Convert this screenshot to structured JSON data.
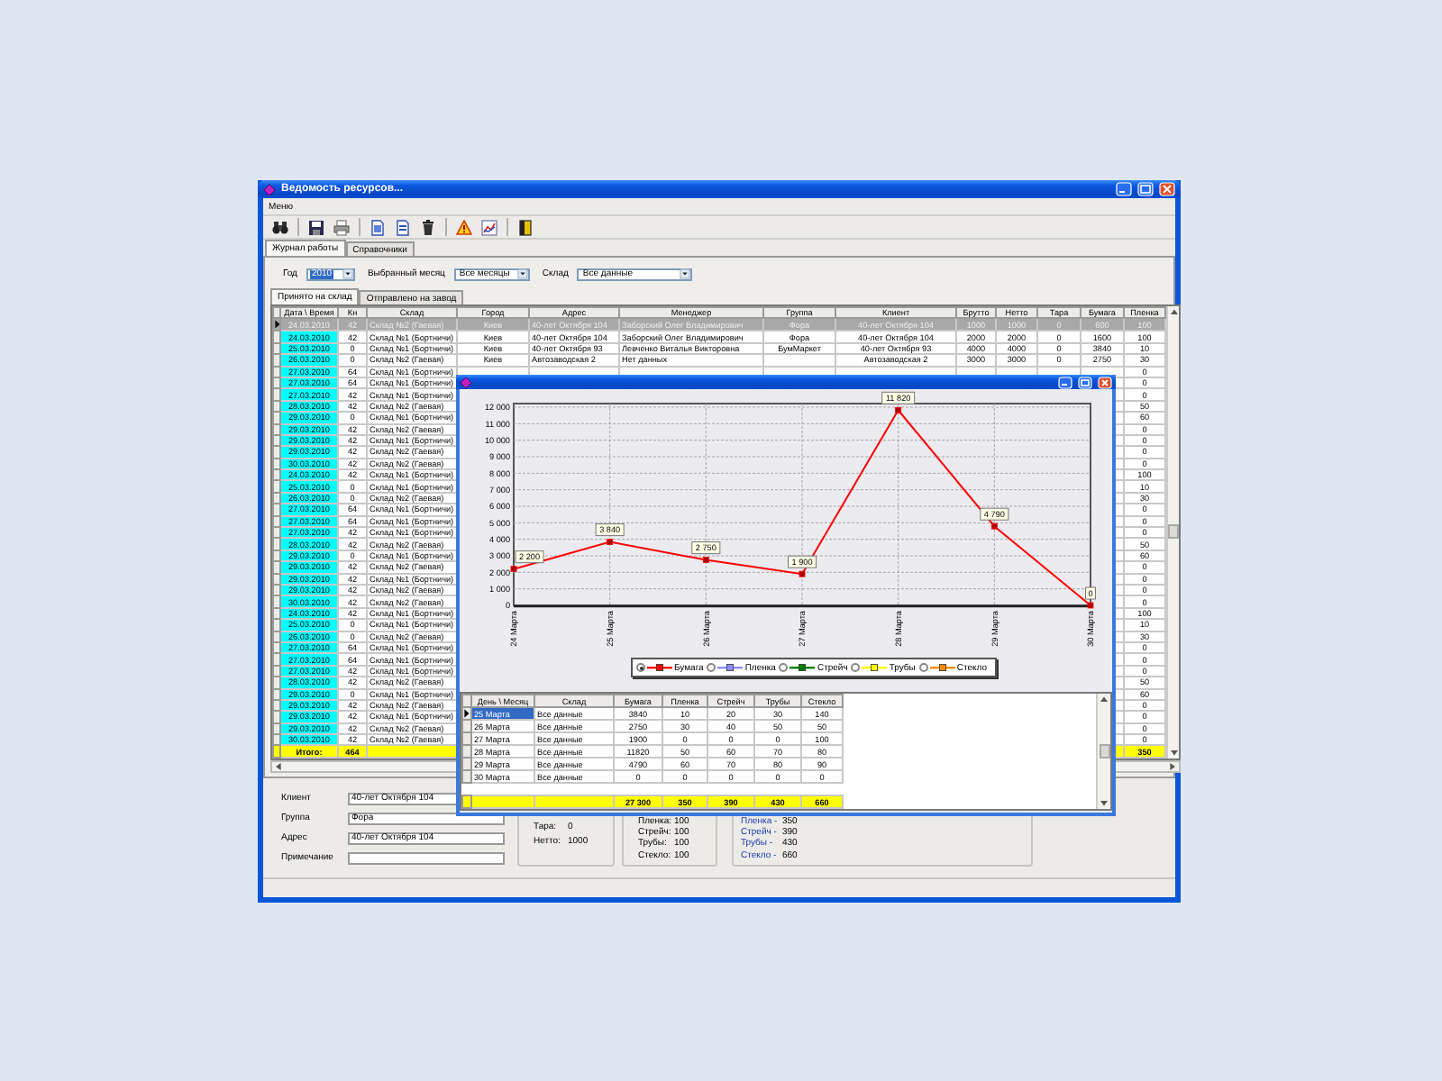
{
  "window": {
    "title": "Ведомость ресурсов..."
  },
  "menu": [
    "Меню"
  ],
  "tabs": [
    {
      "label": "Журнал работы",
      "selected": true
    },
    {
      "label": "Справочники",
      "selected": false
    }
  ],
  "filters": [
    {
      "label": "Год",
      "value": "2010",
      "focused": true
    },
    {
      "label": "Выбранный месяц",
      "value": "Все месяцы",
      "focused": false
    },
    {
      "label": "Склад",
      "value": "Все данные",
      "focused": false
    }
  ],
  "subtabs": [
    {
      "label": "Принято на склад",
      "selected": true
    },
    {
      "label": "Отправлено на завод",
      "selected": false
    }
  ],
  "table": {
    "columns": [
      "Дата \\ Время",
      "Кн",
      "Склад",
      "Город",
      "Адрес",
      "Менеджер",
      "Группа",
      "Клиент",
      "Брутто",
      "Нетто",
      "Тара",
      "Бумага",
      "Пленка"
    ],
    "rows": [
      {
        "selected": true,
        "date": "24.03.2010",
        "kn": "42",
        "warehouse": "Склад №2 (Гаевая)",
        "city": "Киев",
        "address": "40-лет Октября 104",
        "manager": "Заборский Олег Владимирович",
        "group": "Фора",
        "client": "40-лет Октября 104",
        "brutto": "1000",
        "netto": "1000",
        "tara": "0",
        "paper": "600",
        "plenka": "100"
      },
      {
        "selected": false,
        "date": "24.03.2010",
        "kn": "42",
        "warehouse": "Склад №1 (Бортничи)",
        "city": "Киев",
        "address": "40-лет Октября 104",
        "manager": "Заборский Олег Владимирович",
        "group": "Фора",
        "client": "40-лет Октября 104",
        "brutto": "2000",
        "netto": "2000",
        "tara": "0",
        "paper": "1600",
        "plenka": "100"
      },
      {
        "selected": false,
        "date": "25.03.2010",
        "kn": "0",
        "warehouse": "Склад №1 (Бортничи)",
        "city": "Киев",
        "address": "40-лет Октября 93",
        "manager": "Левченко Виталья Викторовна",
        "group": "БумМаркет",
        "client": "40-лет Октября 93",
        "brutto": "4000",
        "netto": "4000",
        "tara": "0",
        "paper": "3840",
        "plenka": "10"
      },
      {
        "selected": false,
        "date": "26.03.2010",
        "kn": "0",
        "warehouse": "Склад №2 (Гаевая)",
        "city": "Киев",
        "address": "Автозаводская 2",
        "manager": "Нет данных",
        "client": "Автозаводская 2",
        "brutto": "3000",
        "netto": "3000",
        "tara": "0",
        "paper": "2750",
        "plenka": "30"
      },
      {
        "selected": false,
        "date": "27.03.2010",
        "kn": "64",
        "warehouse": "Склад №1 (Бортничи)",
        "plenka": "0"
      },
      {
        "selected": false,
        "date": "27.03.2010",
        "kn": "64",
        "warehouse": "Склад №1 (Бортничи)",
        "plenka": "0"
      },
      {
        "selected": false,
        "date": "27.03.2010",
        "kn": "42",
        "warehouse": "Склад №1 (Бортничи)",
        "plenka": "0"
      },
      {
        "selected": false,
        "date": "28.03.2010",
        "kn": "42",
        "warehouse": "Склад №2 (Гаевая)",
        "plenka": "50"
      },
      {
        "selected": false,
        "date": "29.03.2010",
        "kn": "0",
        "warehouse": "Склад №1 (Бортничи)",
        "plenka": "60"
      },
      {
        "selected": false,
        "date": "29.03.2010",
        "kn": "42",
        "warehouse": "Склад №2 (Гаевая)",
        "plenka": "0"
      },
      {
        "selected": false,
        "date": "29.03.2010",
        "kn": "42",
        "warehouse": "Склад №1 (Бортничи)",
        "plenka": "0"
      },
      {
        "selected": false,
        "date": "29.03.2010",
        "kn": "42",
        "warehouse": "Склад №2 (Гаевая)",
        "plenka": "0"
      },
      {
        "selected": false,
        "date": "30.03.2010",
        "kn": "42",
        "warehouse": "Склад №2 (Гаевая)",
        "plenka": "0"
      },
      {
        "selected": false,
        "date": "24.03.2010",
        "kn": "42",
        "warehouse": "Склад №1 (Бортничи)",
        "plenka": "100"
      },
      {
        "selected": false,
        "date": "25.03.2010",
        "kn": "0",
        "warehouse": "Склад №1 (Бортничи)",
        "plenka": "10"
      },
      {
        "selected": false,
        "date": "26.03.2010",
        "kn": "0",
        "warehouse": "Склад №2 (Гаевая)",
        "plenka": "30"
      },
      {
        "selected": false,
        "date": "27.03.2010",
        "kn": "64",
        "warehouse": "Склад №1 (Бортничи)",
        "plenka": "0"
      },
      {
        "selected": false,
        "date": "27.03.2010",
        "kn": "64",
        "warehouse": "Склад №1 (Бортничи)",
        "plenka": "0"
      },
      {
        "selected": false,
        "date": "27.03.2010",
        "kn": "42",
        "warehouse": "Склад №1 (Бортничи)",
        "plenka": "0"
      },
      {
        "selected": false,
        "date": "28.03.2010",
        "kn": "42",
        "warehouse": "Склад №2 (Гаевая)",
        "plenka": "50"
      },
      {
        "selected": false,
        "date": "29.03.2010",
        "kn": "0",
        "warehouse": "Склад №1 (Бортничи)",
        "plenka": "60"
      },
      {
        "selected": false,
        "date": "29.03.2010",
        "kn": "42",
        "warehouse": "Склад №2 (Гаевая)",
        "plenka": "0"
      },
      {
        "selected": false,
        "date": "29.03.2010",
        "kn": "42",
        "warehouse": "Склад №1 (Бортничи)",
        "plenka": "0"
      },
      {
        "selected": false,
        "date": "29.03.2010",
        "kn": "42",
        "warehouse": "Склад №2 (Гаевая)",
        "plenka": "0"
      },
      {
        "selected": false,
        "date": "30.03.2010",
        "kn": "42",
        "warehouse": "Склад №2 (Гаевая)",
        "plenka": "0"
      },
      {
        "selected": false,
        "date": "24.03.2010",
        "kn": "42",
        "warehouse": "Склад №1 (Бортничи)",
        "plenka": "100"
      },
      {
        "selected": false,
        "date": "25.03.2010",
        "kn": "0",
        "warehouse": "Склад №1 (Бортничи)",
        "plenka": "10"
      },
      {
        "selected": false,
        "date": "26.03.2010",
        "kn": "0",
        "warehouse": "Склад №2 (Гаевая)",
        "plenka": "30"
      },
      {
        "selected": false,
        "date": "27.03.2010",
        "kn": "64",
        "warehouse": "Склад №1 (Бортничи)",
        "plenka": "0"
      },
      {
        "selected": false,
        "date": "27.03.2010",
        "kn": "64",
        "warehouse": "Склад №1 (Бортничи)",
        "plenka": "0"
      },
      {
        "selected": false,
        "date": "27.03.2010",
        "kn": "42",
        "warehouse": "Склад №1 (Бортничи)",
        "plenka": "0"
      },
      {
        "selected": false,
        "date": "28.03.2010",
        "kn": "42",
        "warehouse": "Склад №2 (Гаевая)",
        "plenka": "50"
      },
      {
        "selected": false,
        "date": "29.03.2010",
        "kn": "0",
        "warehouse": "Склад №1 (Бортничи)",
        "plenka": "60"
      },
      {
        "selected": false,
        "date": "29.03.2010",
        "kn": "42",
        "warehouse": "Склад №2 (Гаевая)",
        "plenka": "0"
      },
      {
        "selected": false,
        "date": "29.03.2010",
        "kn": "42",
        "warehouse": "Склад №1 (Бортничи)",
        "plenka": "0"
      },
      {
        "selected": false,
        "date": "29.03.2010",
        "kn": "42",
        "warehouse": "Склад №2 (Гаевая)",
        "plenka": "0"
      },
      {
        "selected": false,
        "date": "30.03.2010",
        "kn": "42",
        "warehouse": "Склад №2 (Гаевая)",
        "plenka": "0"
      }
    ],
    "total": {
      "date": "Итого:",
      "kn": "464",
      "plenka": "350"
    }
  },
  "details": {
    "fields": [
      {
        "label": "Клиент",
        "value": "40-лет Октября 104"
      },
      {
        "label": "Группа",
        "value": "Фора"
      },
      {
        "label": "Адрес",
        "value": "40-лет Октября 104"
      },
      {
        "label": "Примечание"
      }
    ],
    "weights": [
      {
        "label": "Тара:",
        "value": "0"
      },
      {
        "label": "Нетто:",
        "value": "1000"
      }
    ],
    "materials": [
      {
        "label": "Пленка:",
        "value": "100"
      },
      {
        "label": "Стрейч:",
        "value": "100"
      },
      {
        "label": "Трубы:",
        "value": "100"
      },
      {
        "label": "Стекло:",
        "value": "100"
      }
    ],
    "totals": [
      {
        "label": "Пленка -",
        "value": "350"
      },
      {
        "label": "Стрейч -",
        "value": "390"
      },
      {
        "label": "Трубы -",
        "value": "430"
      },
      {
        "label": "Стекло -",
        "value": "660"
      }
    ]
  },
  "chart_window": {
    "chart_data": {
      "type": "line",
      "categories": [
        "24 Марта",
        "25 Марта",
        "26 Марта",
        "27 Марта",
        "28 Марта",
        "29 Марта",
        "30 Марта"
      ],
      "series": [
        {
          "name": "Бумага",
          "color": "#ff0000",
          "marker": "square",
          "values": [
            2200,
            3840,
            2750,
            1900,
            11820,
            4790,
            0
          ]
        }
      ],
      "grid": true,
      "ylim": [
        0,
        12000
      ],
      "yticks": [
        {
          "value": 0,
          "label": "0"
        },
        {
          "value": 1000,
          "label": "1 000"
        },
        {
          "value": 2000,
          "label": "2 000"
        },
        {
          "value": 3000,
          "label": "3 000"
        },
        {
          "value": 4000,
          "label": "4 000"
        },
        {
          "value": 5000,
          "label": "5 000"
        },
        {
          "value": 6000,
          "label": "6 000"
        },
        {
          "value": 7000,
          "label": "7 000"
        },
        {
          "value": 8000,
          "label": "8 000"
        },
        {
          "value": 9000,
          "label": "9 000"
        },
        {
          "value": 10000,
          "label": "10 000"
        },
        {
          "value": 11000,
          "label": "11 000"
        },
        {
          "value": 12000,
          "label": "12 000"
        }
      ],
      "value_labels": [
        "2 200",
        "3 840",
        "2 750",
        "1 900",
        "11 820",
        "4 790",
        "0"
      ]
    },
    "legend": [
      {
        "selected": true
      },
      {
        "label": "Пленка",
        "color": "#8c8cff",
        "selected": false
      },
      {
        "label": "Стрейч",
        "color": "#008000",
        "selected": false
      },
      {
        "label": "Трубы",
        "color": "#ffff00",
        "selected": false
      },
      {
        "label": "Стекло",
        "color": "#ff8c00",
        "selected": false
      }
    ],
    "grid": {
      "columns": [
        "День \\ Месяц",
        "Склад",
        "Бумага",
        "Пленка",
        "Стрейч",
        "Трубы",
        "Стекло"
      ],
      "rows": [
        {
          "selected": true,
          "cells": [
            "25 Марта",
            "Все данные",
            "3840",
            "10",
            "20",
            "30",
            "140"
          ]
        },
        {
          "selected": false,
          "cells": [
            "26 Марта",
            "Все данные",
            "2750",
            "30",
            "40",
            "50",
            "50"
          ]
        },
        {
          "selected": false,
          "cells": [
            "27 Марта",
            "Все данные",
            "1900",
            "0",
            "0",
            "0",
            "100"
          ]
        },
        {
          "selected": false,
          "cells": [
            "28 Марта",
            "Все данные",
            "11820",
            "50",
            "60",
            "70",
            "80"
          ]
        },
        {
          "selected": false,
          "cells": [
            "29 Марта",
            "Все данные",
            "4790",
            "60",
            "70",
            "80",
            "90"
          ]
        },
        {
          "selected": false,
          "cells": [
            "30 Марта",
            "Все данные",
            "0",
            "0",
            "0",
            "0",
            "0"
          ]
        }
      ],
      "totals": [
        "27 300",
        "350",
        "390",
        "430",
        "660"
      ]
    }
  }
}
